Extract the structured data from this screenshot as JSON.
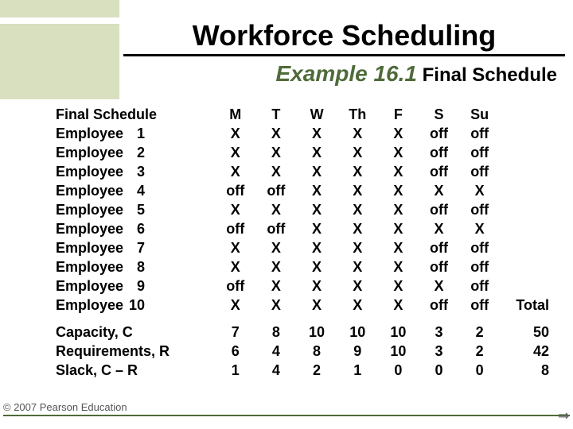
{
  "title": "Workforce Scheduling",
  "subtitle_em": "Example 16.1",
  "subtitle_plain": " Final Schedule",
  "table_header_left": "Final Schedule",
  "days": [
    "M",
    "T",
    "W",
    "Th",
    "F",
    "S",
    "Su"
  ],
  "total_label": "Total",
  "chart_data": {
    "type": "table",
    "title": "Final Schedule",
    "columns": [
      "Employee",
      "M",
      "T",
      "W",
      "Th",
      "F",
      "S",
      "Su"
    ],
    "rows": [
      {
        "label": "Employee",
        "num": "1",
        "cells": [
          "X",
          "X",
          "X",
          "X",
          "X",
          "off",
          "off"
        ]
      },
      {
        "label": "Employee",
        "num": "2",
        "cells": [
          "X",
          "X",
          "X",
          "X",
          "X",
          "off",
          "off"
        ]
      },
      {
        "label": "Employee",
        "num": "3",
        "cells": [
          "X",
          "X",
          "X",
          "X",
          "X",
          "off",
          "off"
        ]
      },
      {
        "label": "Employee",
        "num": "4",
        "cells": [
          "off",
          "off",
          "X",
          "X",
          "X",
          "X",
          "X"
        ]
      },
      {
        "label": "Employee",
        "num": "5",
        "cells": [
          "X",
          "X",
          "X",
          "X",
          "X",
          "off",
          "off"
        ]
      },
      {
        "label": "Employee",
        "num": "6",
        "cells": [
          "off",
          "off",
          "X",
          "X",
          "X",
          "X",
          "X"
        ]
      },
      {
        "label": "Employee",
        "num": "7",
        "cells": [
          "X",
          "X",
          "X",
          "X",
          "X",
          "off",
          "off"
        ]
      },
      {
        "label": "Employee",
        "num": "8",
        "cells": [
          "X",
          "X",
          "X",
          "X",
          "X",
          "off",
          "off"
        ]
      },
      {
        "label": "Employee",
        "num": "9",
        "cells": [
          "off",
          "X",
          "X",
          "X",
          "X",
          "X",
          "off"
        ]
      },
      {
        "label": "Employee",
        "num": "10",
        "cells": [
          "X",
          "X",
          "X",
          "X",
          "X",
          "off",
          "off"
        ]
      }
    ],
    "summary": [
      {
        "label": "Capacity, C",
        "cells": [
          "7",
          "8",
          "10",
          "10",
          "10",
          "3",
          "2"
        ],
        "total": "50"
      },
      {
        "label": "Requirements, R",
        "cells": [
          "6",
          "4",
          "8",
          "9",
          "10",
          "3",
          "2"
        ],
        "total": "42"
      },
      {
        "label": "Slack, C – R",
        "cells": [
          "1",
          "4",
          "2",
          "1",
          "0",
          "0",
          "0"
        ],
        "total": "8"
      }
    ]
  },
  "footer": "© 2007 Pearson Education"
}
